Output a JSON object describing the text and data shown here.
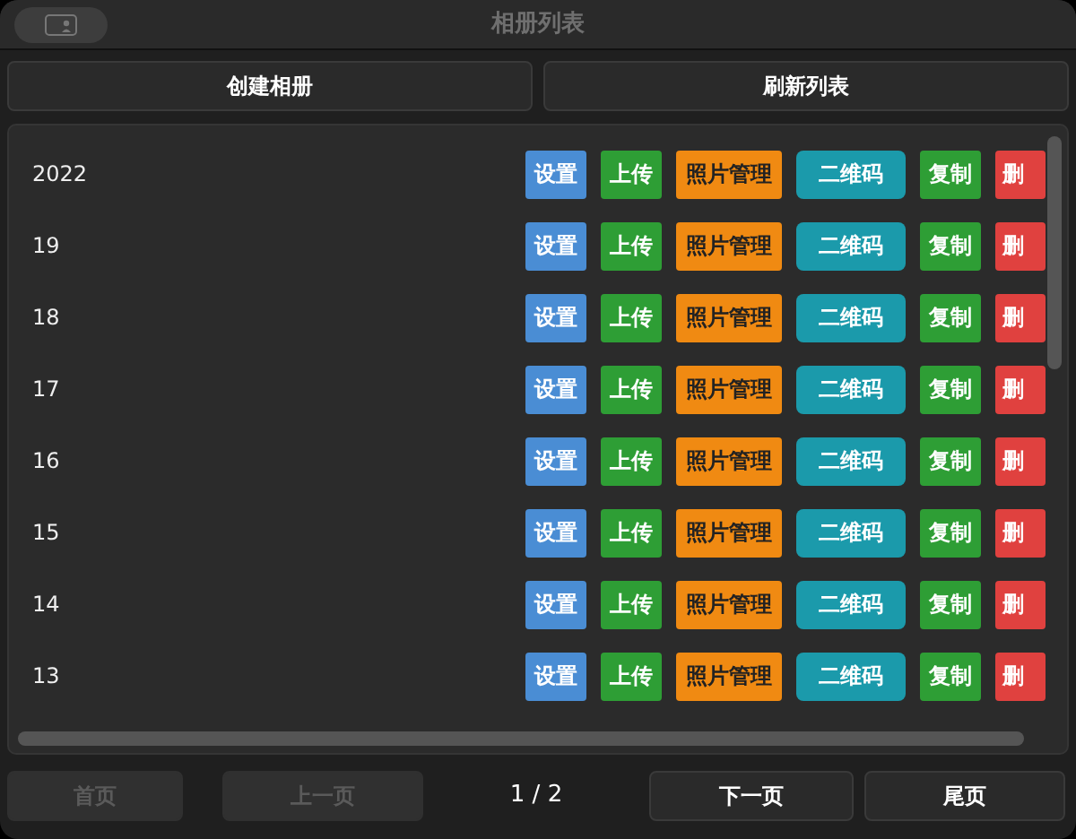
{
  "window": {
    "title": "相册列表"
  },
  "toolbar": [
    {
      "label": "创建相册"
    },
    {
      "label": "刷新列表"
    }
  ],
  "albums": [
    {
      "name": "2022",
      "actions": [
        {
          "kind": "settings",
          "label": "设置"
        },
        {
          "kind": "upload",
          "label": "上传"
        },
        {
          "kind": "photos",
          "label": "照片管理"
        },
        {
          "kind": "qrcode",
          "label": "二维码"
        },
        {
          "kind": "copy",
          "label": "复制"
        },
        {
          "kind": "delete",
          "label": "删"
        }
      ]
    },
    {
      "name": "19",
      "actions": [
        {
          "kind": "settings",
          "label": "设置"
        },
        {
          "kind": "upload",
          "label": "上传"
        },
        {
          "kind": "photos",
          "label": "照片管理"
        },
        {
          "kind": "qrcode",
          "label": "二维码"
        },
        {
          "kind": "copy",
          "label": "复制"
        },
        {
          "kind": "delete",
          "label": "删"
        }
      ]
    },
    {
      "name": "18",
      "actions": [
        {
          "kind": "settings",
          "label": "设置"
        },
        {
          "kind": "upload",
          "label": "上传"
        },
        {
          "kind": "photos",
          "label": "照片管理"
        },
        {
          "kind": "qrcode",
          "label": "二维码"
        },
        {
          "kind": "copy",
          "label": "复制"
        },
        {
          "kind": "delete",
          "label": "删"
        }
      ]
    },
    {
      "name": "17",
      "actions": [
        {
          "kind": "settings",
          "label": "设置"
        },
        {
          "kind": "upload",
          "label": "上传"
        },
        {
          "kind": "photos",
          "label": "照片管理"
        },
        {
          "kind": "qrcode",
          "label": "二维码"
        },
        {
          "kind": "copy",
          "label": "复制"
        },
        {
          "kind": "delete",
          "label": "删"
        }
      ]
    },
    {
      "name": "16",
      "actions": [
        {
          "kind": "settings",
          "label": "设置"
        },
        {
          "kind": "upload",
          "label": "上传"
        },
        {
          "kind": "photos",
          "label": "照片管理"
        },
        {
          "kind": "qrcode",
          "label": "二维码"
        },
        {
          "kind": "copy",
          "label": "复制"
        },
        {
          "kind": "delete",
          "label": "删"
        }
      ]
    },
    {
      "name": "15",
      "actions": [
        {
          "kind": "settings",
          "label": "设置"
        },
        {
          "kind": "upload",
          "label": "上传"
        },
        {
          "kind": "photos",
          "label": "照片管理"
        },
        {
          "kind": "qrcode",
          "label": "二维码"
        },
        {
          "kind": "copy",
          "label": "复制"
        },
        {
          "kind": "delete",
          "label": "删"
        }
      ]
    },
    {
      "name": "14",
      "actions": [
        {
          "kind": "settings",
          "label": "设置"
        },
        {
          "kind": "upload",
          "label": "上传"
        },
        {
          "kind": "photos",
          "label": "照片管理"
        },
        {
          "kind": "qrcode",
          "label": "二维码"
        },
        {
          "kind": "copy",
          "label": "复制"
        },
        {
          "kind": "delete",
          "label": "删"
        }
      ]
    },
    {
      "name": "13",
      "actions": [
        {
          "kind": "settings",
          "label": "设置"
        },
        {
          "kind": "upload",
          "label": "上传"
        },
        {
          "kind": "photos",
          "label": "照片管理"
        },
        {
          "kind": "qrcode",
          "label": "二维码"
        },
        {
          "kind": "copy",
          "label": "复制"
        },
        {
          "kind": "delete",
          "label": "删"
        }
      ]
    }
  ],
  "pagination": {
    "buttons": [
      {
        "label": "首页",
        "disabled": true
      },
      {
        "label": "上一页",
        "disabled": true
      },
      {
        "label": "下一页",
        "disabled": false
      },
      {
        "label": "尾页",
        "disabled": false
      }
    ],
    "page": "1 / 2"
  }
}
